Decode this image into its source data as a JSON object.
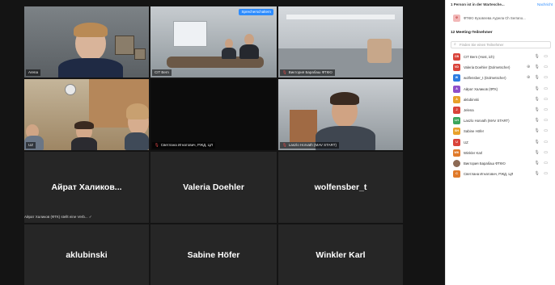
{
  "gallery": {
    "spotlight_badge": "Sprecherschaltern",
    "chat_notice": "Айрат Халиков (ФТК) stellt eine Verb...",
    "tiles": [
      {
        "label": "Arena",
        "muted": false,
        "big": false
      },
      {
        "label": "CIT Bern",
        "muted": false,
        "big": false
      },
      {
        "label": "Виктория Барабаш ФТКЮ",
        "muted": true,
        "big": false
      },
      {
        "label": "UZ",
        "muted": false,
        "big": false
      },
      {
        "label": "Светлана Игнатович, РЖД, ЦЛ",
        "muted": true,
        "big": false
      },
      {
        "label": "Laszlo Horvath (MAV START)",
        "muted": true,
        "big": false
      },
      {
        "label": "Айрат  Халиков...",
        "big": true
      },
      {
        "label": "Valeria Doehler",
        "big": true
      },
      {
        "label": "wolfensber_t",
        "big": true
      },
      {
        "label": "aklubinski",
        "big": true
      },
      {
        "label": "Sabine Höfer",
        "big": true
      },
      {
        "label": "Winkler Karl",
        "big": true
      }
    ]
  },
  "panel": {
    "waiting_header": "1 Person ist in der Wartesche...",
    "message_link": "Nachricht",
    "waiting_person": "ФТКЮ Кузовлева Аурела Ch Serrano...",
    "section_title": "12 Meeting-Teilnehmer",
    "search_placeholder": "Finden Sie einen Teilnehmer",
    "participants": [
      {
        "initials": "CB",
        "color": "#d9433a",
        "name": "CIT Bern (Host, ich)",
        "icons": "🎙 ▭",
        "red": false
      },
      {
        "initials": "VD",
        "color": "#d9433a",
        "name": "Valeria Doehler (Dolmetscher)",
        "icons": "⊕ 🎙 ▭",
        "red": true
      },
      {
        "initials": "W",
        "color": "#2d7be0",
        "name": "wolfensber_t (Dolmetscher)",
        "icons": "⊕ 🎙 ▭",
        "red": true
      },
      {
        "initials": "A",
        "color": "#8e4fc9",
        "name": "Айрат Халиков (ФТК)",
        "icons": "🎙 ▭",
        "red": true
      },
      {
        "initials": "A",
        "color": "#e8a12a",
        "name": "aklubinski",
        "icons": "🎙 ▭",
        "red": true
      },
      {
        "initials": "J",
        "color": "#d9433a",
        "name": "Jelena",
        "icons": "🎙 ▭",
        "red": true
      },
      {
        "initials": "LH",
        "color": "#3aa55a",
        "name": "Laszlo Horvath (MAV START)",
        "icons": "🎙 ▭",
        "red": true
      },
      {
        "initials": "SH",
        "color": "#e8a12a",
        "name": "Sabine Höfer",
        "icons": "🎙 ▭",
        "red": true
      },
      {
        "initials": "U",
        "color": "#d9433a",
        "name": "UZ",
        "icons": "🎙 ▭",
        "red": true
      },
      {
        "initials": "WK",
        "color": "#e07a2a",
        "name": "Winkler Karl",
        "icons": "🎙 ▭",
        "red": true
      },
      {
        "initials": "",
        "color": "#8c6a55",
        "name": "Виктория Барабаш ФТКЮ",
        "icons": "🎙 ▭",
        "red": true
      },
      {
        "initials": "C",
        "color": "#e07a2a",
        "name": "Светлана Игнатович, РЖД, ЦЛ",
        "icons": "🎙 ▭",
        "red": true
      }
    ]
  }
}
